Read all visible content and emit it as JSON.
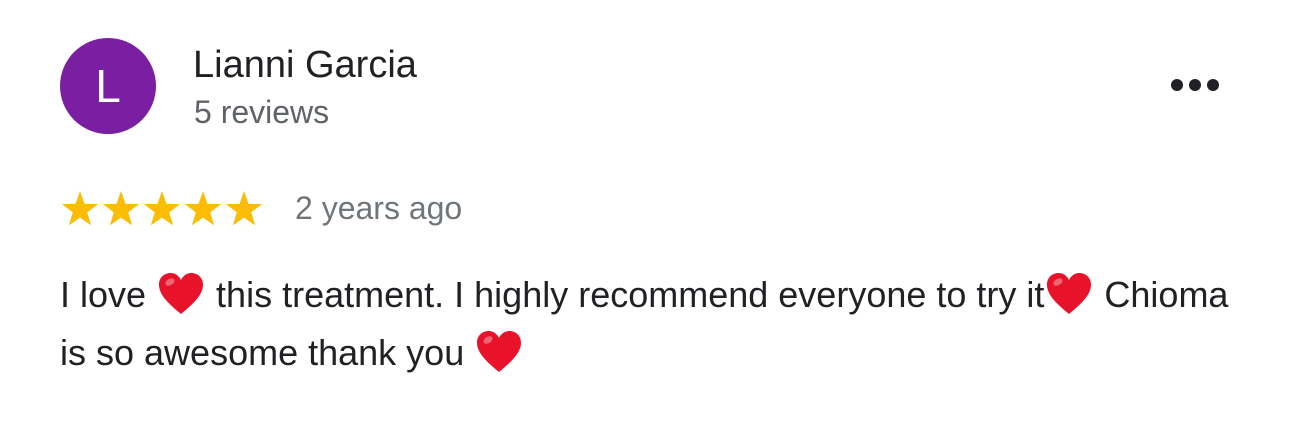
{
  "review": {
    "avatar_letter": "L",
    "avatar_color": "#7b1fa2",
    "author": "Lianni Garcia",
    "author_meta": "5 reviews",
    "rating": 5,
    "rating_max": 5,
    "star_color": "#fbbc04",
    "time": "2 years ago",
    "text_parts": [
      "I love ",
      " this treatment. I highly recommend everyone to try it",
      " Chioma is so awesome thank you "
    ],
    "heart_color": "#e8132a"
  },
  "icons": {
    "more": "more-horizontal-icon",
    "star": "star-icon",
    "heart": "red-heart-emoji-icon"
  }
}
